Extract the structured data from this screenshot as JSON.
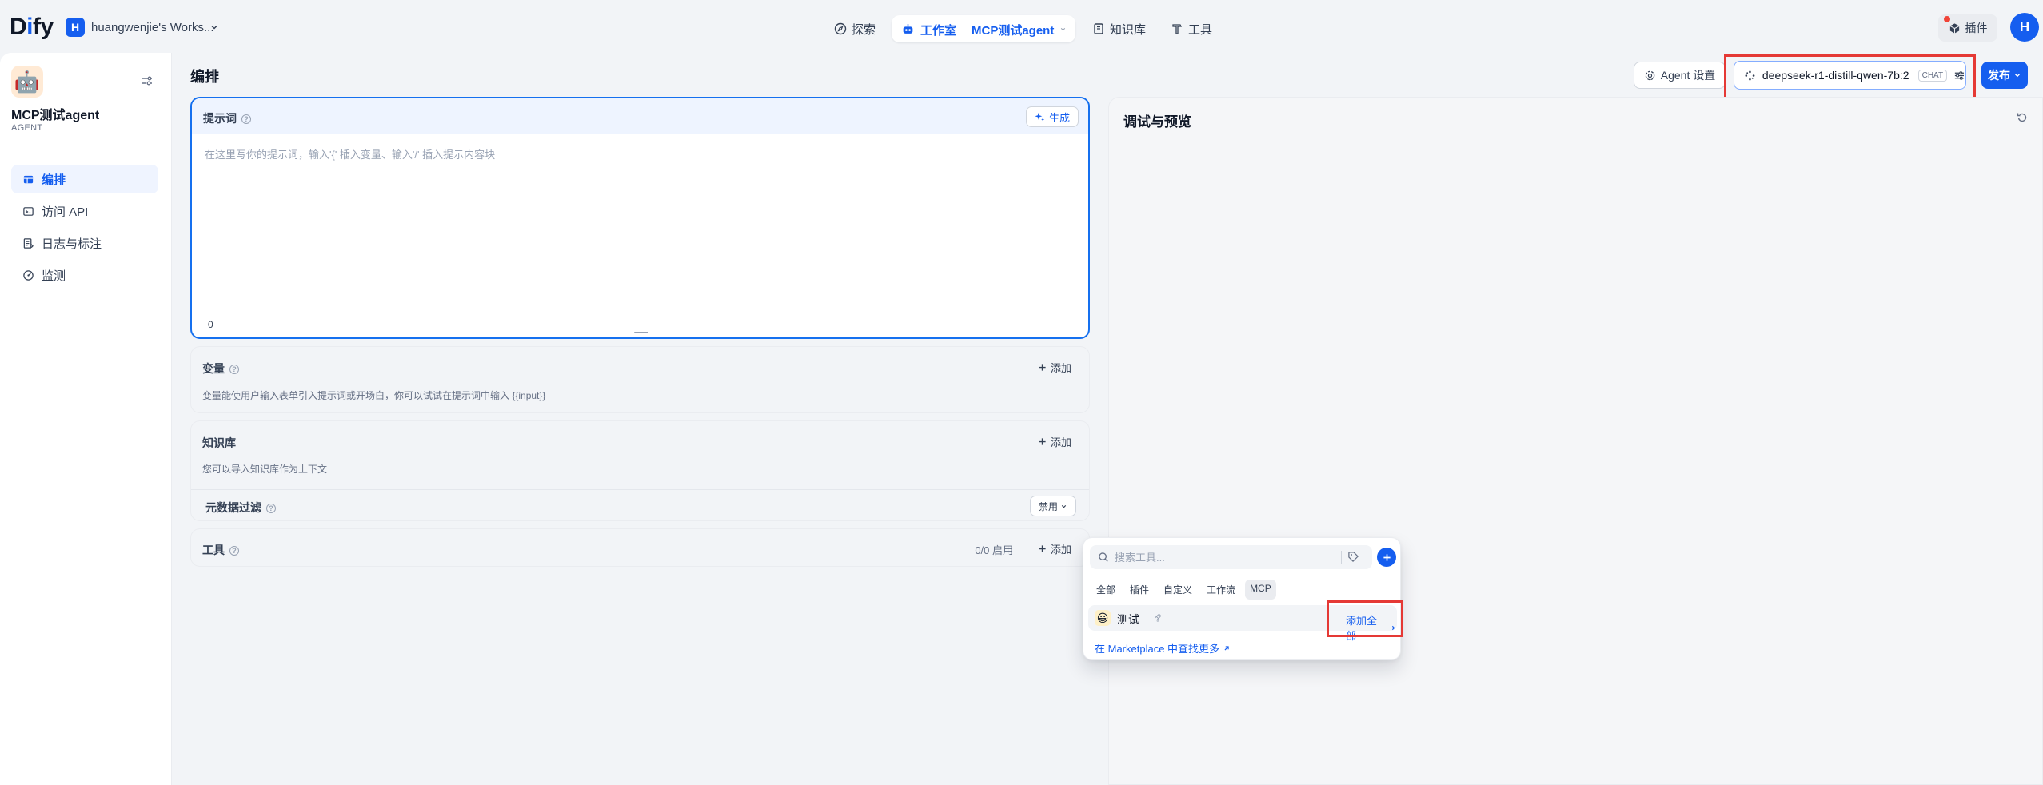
{
  "topbar": {
    "logo_prefix": "D",
    "logo_i": "i",
    "logo_suffix": "fy",
    "workspace_initial": "H",
    "workspace_name": "huangwenjie's Works...",
    "nav": {
      "explore": "探索",
      "studio": "工作室",
      "current_app": "MCP测试agent",
      "knowledge": "知识库",
      "tools": "工具"
    },
    "plugins": "插件",
    "user_initial": "H"
  },
  "sidebar": {
    "app_icon": "🤖",
    "app_name": "MCP测试agent",
    "app_type": "AGENT",
    "items": [
      {
        "label": "编排",
        "icon": "layout-icon",
        "active": true
      },
      {
        "label": "访问 API",
        "icon": "terminal-icon",
        "active": false
      },
      {
        "label": "日志与标注",
        "icon": "logs-icon",
        "active": false
      },
      {
        "label": "监测",
        "icon": "monitor-icon",
        "active": false
      }
    ]
  },
  "header": {
    "title": "编排",
    "agent_settings": "Agent 设置",
    "model_name": "deepseek-r1-distill-qwen-7b:2",
    "model_mode": "CHAT",
    "publish": "发布"
  },
  "prompt": {
    "title": "提示词",
    "generate": "生成",
    "placeholder": "在这里写你的提示词，输入'{' 插入变量、输入'/' 插入提示内容块",
    "count": "0"
  },
  "variables": {
    "title": "变量",
    "add": "添加",
    "desc": "变量能使用户输入表单引入提示词或开场白，你可以试试在提示词中输入 {{input}}"
  },
  "knowledge": {
    "title": "知识库",
    "add": "添加",
    "desc": "您可以导入知识库作为上下文",
    "metadata_filter": "元数据过滤",
    "metadata_value": "禁用"
  },
  "tools": {
    "title": "工具",
    "enabled": "0/0 启用",
    "add": "添加"
  },
  "debug": {
    "title": "调试与预览"
  },
  "popup": {
    "search_placeholder": "搜索工具...",
    "tabs": [
      "全部",
      "插件",
      "自定义",
      "工作流",
      "MCP"
    ],
    "active_tab": "MCP",
    "tool_icon": "😀",
    "tool_name": "测试",
    "add_all": "添加全部",
    "marketplace": "在 Marketplace 中查找更多"
  },
  "colors": {
    "accent": "#155eef",
    "highlight": "#e53935"
  }
}
